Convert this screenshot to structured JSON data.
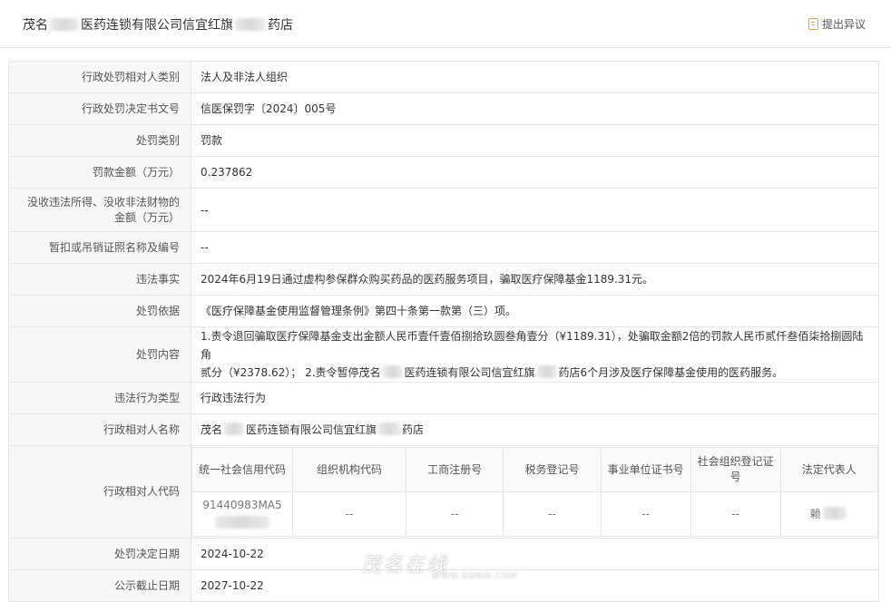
{
  "header": {
    "title_part1": "茂名",
    "title_part2": "医药连锁有限公司信宜红旗",
    "title_part3": "药店",
    "objection_label": "提出异议"
  },
  "rows": {
    "r1": {
      "label": "行政处罚相对人类别",
      "value": "法人及非法人组织"
    },
    "r2": {
      "label": "行政处罚决定书文号",
      "value": "信医保罚字〔2024〕005号"
    },
    "r3": {
      "label": "处罚类别",
      "value": "罚款"
    },
    "r4": {
      "label": "罚款金额（万元）",
      "value": "0.237862"
    },
    "r5": {
      "label_line1": "没收违法所得、没收非法财物的",
      "label_line2": "金额（万元）",
      "value": "--"
    },
    "r6": {
      "label": "暂扣或吊销证照名称及编号",
      "value": "--"
    },
    "r7": {
      "label": "违法事实",
      "value": "2024年6月19日通过虚构参保群众购买药品的医药服务项目，骗取医疗保障基金1189.31元。"
    },
    "r8": {
      "label": "处罚依据",
      "value": "《医疗保障基金使用监督管理条例》第四十条第一款第（三）项。"
    },
    "r9": {
      "label": "处罚内容",
      "value_line1": "1.责令退回骗取医疗保障基金支出金额人民币壹仟壹佰捌拾玖圆叁角壹分（¥1189.31），处骗取金额2倍的罚款人民币贰仟叁佰柒拾捌圆陆角",
      "value_line2a": "贰分（¥2378.62）；  2.责令暂停茂名",
      "value_line2b": "医药连锁有限公司信宜红旗",
      "value_line2c": "药店6个月涉及医疗保障基金使用的医药服务。"
    },
    "r10": {
      "label": "违法行为类型",
      "value": "行政违法行为"
    },
    "r11": {
      "label": "行政相对人名称",
      "value_a": "茂名",
      "value_b": "医药连锁有限公司信宜红旗",
      "value_c": "药店"
    },
    "r12": {
      "label": "行政相对人代码",
      "headers": [
        "统一社会信用代码",
        "组织机构代码",
        "工商注册号",
        "税务登记号",
        "事业单位证书号",
        "社会组织登记证号",
        "法定代表人"
      ],
      "credit_code": "91440983MA5",
      "cells": [
        "--",
        "--",
        "--",
        "--",
        "--"
      ],
      "legal_rep": "赖"
    },
    "r13": {
      "label": "处罚决定日期",
      "value": "2024-10-22"
    },
    "r14": {
      "label": "公示截止日期",
      "value": "2027-10-22"
    }
  },
  "watermark": {
    "text": "茂名在线",
    "url": "WWW.GDMM.COM"
  }
}
